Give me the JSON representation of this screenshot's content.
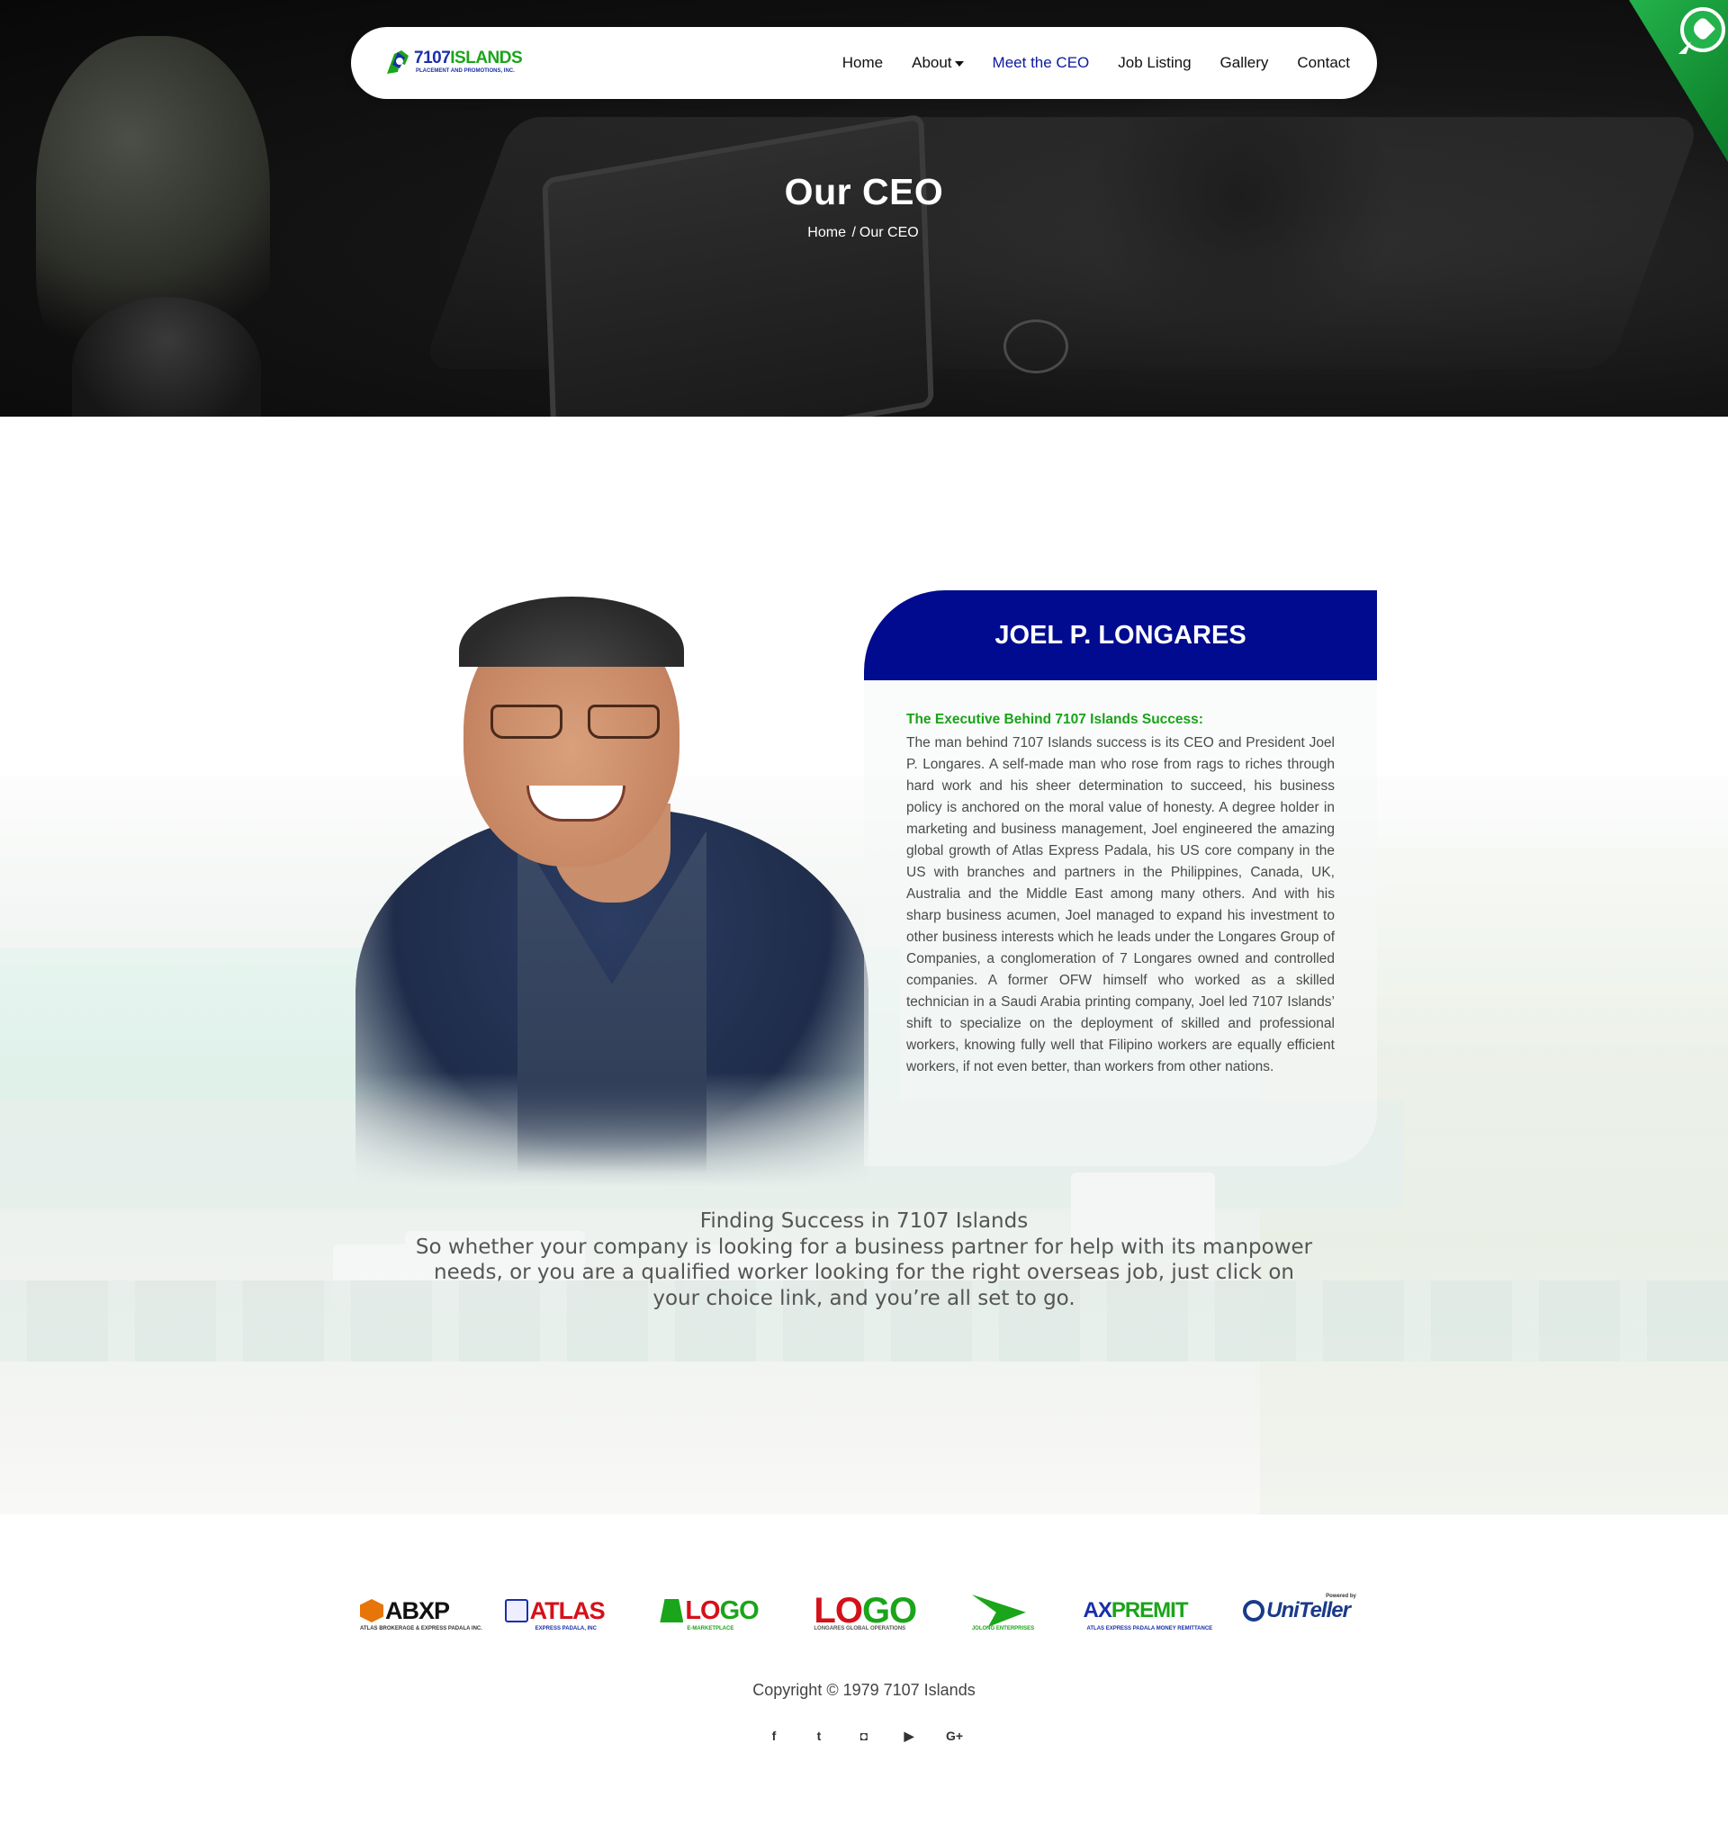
{
  "brand": {
    "name_part1": "7107",
    "name_part2": "ISLANDS",
    "tagline": "PLACEMENT AND PROMOTIONS, INC."
  },
  "nav": {
    "items": [
      {
        "label": "Home"
      },
      {
        "label": "About"
      },
      {
        "label": "Meet the CEO"
      },
      {
        "label": "Job Listing"
      },
      {
        "label": "Gallery"
      },
      {
        "label": "Contact"
      }
    ],
    "active": "Meet the CEO"
  },
  "hero": {
    "title": "Our CEO",
    "breadcrumb_home": "Home",
    "breadcrumb_sep": "/",
    "breadcrumb_current": "Our CEO"
  },
  "ceo": {
    "name": "JOEL P. LONGARES",
    "heading": "The Executive Behind 7107 Islands Success:",
    "bio": "The man behind 7107 Islands success is its CEO and President Joel P. Longares. A self-made man who rose from rags to riches through hard work and his sheer determination to succeed, his business policy is anchored on the moral value of honesty. A degree holder in marketing and business management, Joel engineered the amazing global growth of Atlas Express Padala, his US core company in the US with branches and partners in the Philippines, Canada, UK, Australia and the Middle East among many others. And with his sharp business acumen, Joel managed to expand his investment to other business interests which he leads under the Longares Group of Companies, a conglomeration of 7 Longares owned and controlled companies. A former OFW himself who worked as a skilled technician in a Saudi Arabia printing company, Joel led 7107 Islands’ shift to specialize on the deployment of skilled and professional workers, knowing fully well that Filipino workers are equally efficient workers, if not even better, than workers from other nations."
  },
  "cta": {
    "title": "Finding Success in 7107 Islands",
    "body": "So whether your company is looking for a business partner for help with its manpower needs, or you are a qualified worker looking for the right overseas job, just click on your choice link, and you’re all set to go."
  },
  "partners": [
    {
      "name": "ABXP",
      "sub": "ATLAS BROKERAGE & EXPRESS PADALA INC."
    },
    {
      "name": "ATLAS",
      "sub": "EXPRESS PADALA, INC"
    },
    {
      "name_a": "LO",
      "name_b": "GO",
      "sub": "E-MARKETPLACE"
    },
    {
      "name_a": "LO",
      "name_b": "GO",
      "sub": "LONGARES GLOBAL OPERATIONS"
    },
    {
      "sub": "JOLONG ENTERPRISES"
    },
    {
      "name_a": "AX",
      "name_b": "PREMIT",
      "sub": "ATLAS EXPRESS PADALA MONEY REMITTANCE"
    },
    {
      "name": "UniTeller",
      "sub": "Powered by"
    }
  ],
  "footer": {
    "copyright": "Copyright © 1979 7107 Islands",
    "socials": [
      {
        "icon": "facebook-icon",
        "glyph": "f"
      },
      {
        "icon": "twitter-icon",
        "glyph": "t"
      },
      {
        "icon": "instagram-icon",
        "glyph": "◘"
      },
      {
        "icon": "youtube-icon",
        "glyph": "▶"
      },
      {
        "icon": "google-plus-icon",
        "glyph": "G+"
      }
    ]
  },
  "colors": {
    "nav_active": "#0a1aa0",
    "name_card": "#000b8f",
    "heading_green": "#19a319",
    "whatsapp": "#23b24b"
  }
}
